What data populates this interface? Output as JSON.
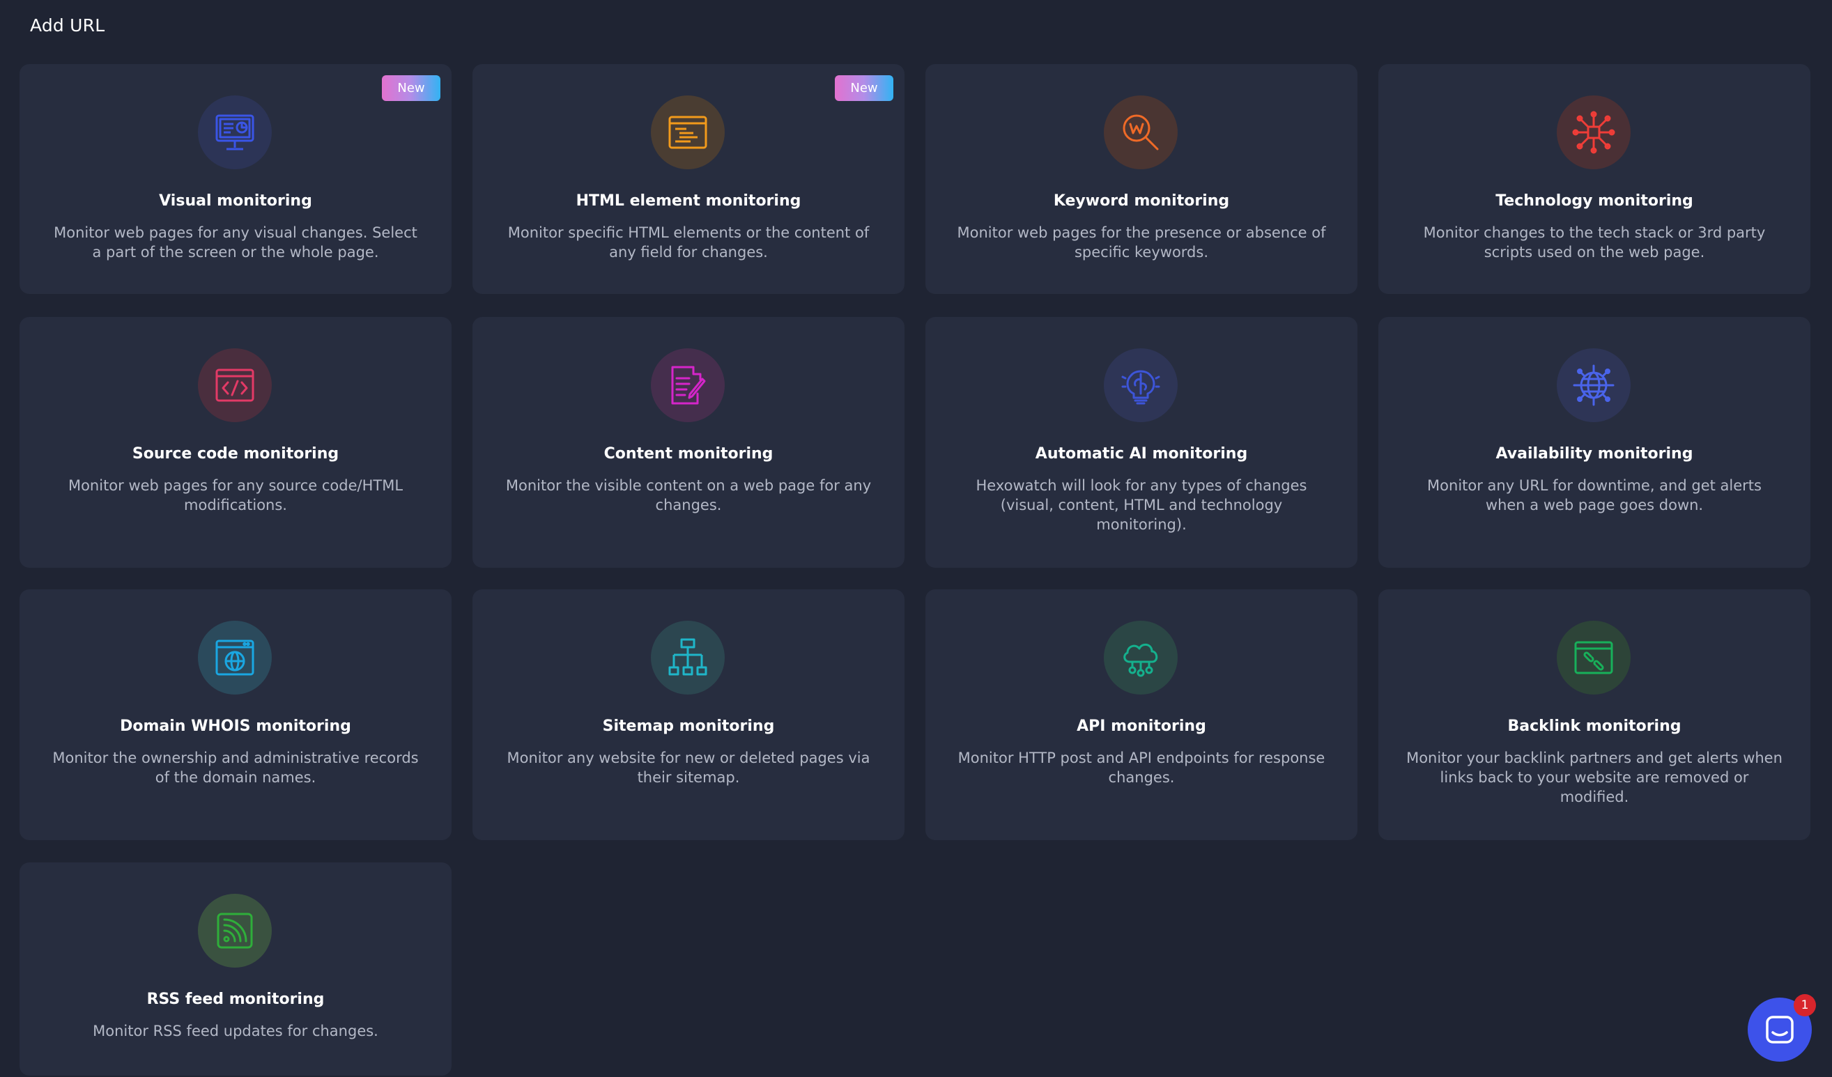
{
  "page": {
    "title": "Add URL"
  },
  "badge_label": "New",
  "cards": [
    {
      "title": "Visual monitoring",
      "desc": "Monitor web pages for any visual changes. Select a part of the screen or the whole page.",
      "badge": "New",
      "icon": "monitor-icon",
      "color": "#3a55e6",
      "bg": "#2c3456"
    },
    {
      "title": "HTML element monitoring",
      "desc": "Monitor specific HTML elements or the content of any field for changes.",
      "badge": "New",
      "icon": "html-element-icon",
      "color": "#f29a1b",
      "bg": "#4a3d32"
    },
    {
      "title": "Keyword monitoring",
      "desc": "Monitor web pages for the presence or absence of specific keywords.",
      "icon": "keyword-search-icon",
      "color": "#ef6a27",
      "bg": "#4a3532"
    },
    {
      "title": "Technology monitoring",
      "desc": "Monitor changes to the tech stack or 3rd party scripts used on the web page.",
      "icon": "technology-icon",
      "color": "#ef3d38",
      "bg": "#4a3035"
    },
    {
      "title": "Source code monitoring",
      "desc": "Monitor web pages for any source code/HTML modifications.",
      "icon": "source-code-icon",
      "color": "#e33a66",
      "bg": "#4a2e3e"
    },
    {
      "title": "Content monitoring",
      "desc": "Monitor the visible content on a web page for any changes.",
      "icon": "content-edit-icon",
      "color": "#d525c9",
      "bg": "#452e4d"
    },
    {
      "title": "Automatic AI monitoring",
      "desc": "Hexowatch will look for any types of changes (visual, content, HTML and technology monitoring).",
      "icon": "ai-brain-icon",
      "color": "#3d55d8",
      "bg": "#2e3556"
    },
    {
      "title": "Availability monitoring",
      "desc": "Monitor any URL for downtime, and get alerts when a web page goes down.",
      "icon": "globe-network-icon",
      "color": "#4a64ea",
      "bg": "#2e3556"
    },
    {
      "title": "Domain WHOIS monitoring",
      "desc": "Monitor the ownership and administrative records of the domain names.",
      "icon": "domain-whois-icon",
      "color": "#1aa7e2",
      "bg": "#2b4a5c"
    },
    {
      "title": "Sitemap monitoring",
      "desc": "Monitor any website for new or deleted pages via their sitemap.",
      "icon": "sitemap-icon",
      "color": "#1fb6c9",
      "bg": "#2c4650"
    },
    {
      "title": "API monitoring",
      "desc": "Monitor HTTP post and API endpoints for response changes.",
      "icon": "api-cloud-icon",
      "color": "#15b08d",
      "bg": "#2b4645"
    },
    {
      "title": "Backlink monitoring",
      "desc": "Monitor your backlink partners and get alerts when links back to your website are removed or modified.",
      "icon": "backlink-icon",
      "color": "#18b05a",
      "bg": "#2d4438"
    },
    {
      "title": "RSS feed monitoring",
      "desc": "Monitor RSS feed updates for changes.",
      "icon": "rss-feed-icon",
      "color": "#2fae3a",
      "bg": "#3a5240"
    }
  ],
  "chat": {
    "badge_count": "1"
  }
}
